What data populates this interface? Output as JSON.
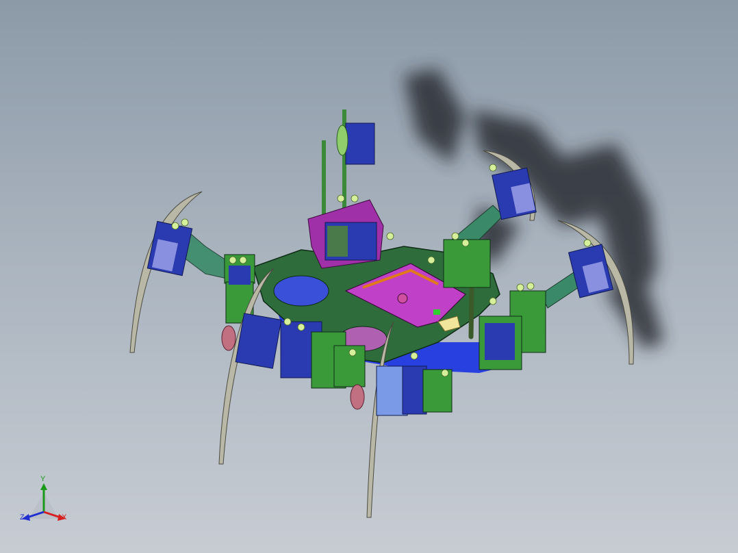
{
  "viewport": {
    "background_top": "#8c9aa8",
    "background_bottom": "#c7ccd3"
  },
  "model": {
    "colors": {
      "board_plate": "#2e6d3b",
      "bracket_green": "#3a9a3a",
      "servo_blue": "#2a3ab0",
      "servo_face": "#8a90e0",
      "leg_tip": "#b9b8a6",
      "base_blue": "#2840e0",
      "controller_board": "#c040c8",
      "bracket_magenta": "#a030a8",
      "shadow": "#2a2f36"
    }
  },
  "triad": {
    "x_label": "X",
    "y_label": "Y",
    "z_label": "Z",
    "x_color": "#d62020",
    "y_color": "#1a9a1a",
    "z_color": "#2030d0"
  }
}
